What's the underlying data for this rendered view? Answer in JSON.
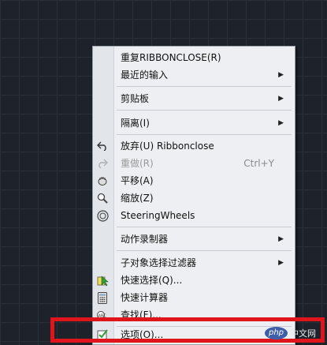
{
  "context_menu": {
    "items": [
      {
        "label": "重复RIBBONCLOSE(R)",
        "icon": "",
        "accel": "",
        "submenu": false
      },
      {
        "label": "最近的输入",
        "icon": "",
        "accel": "",
        "submenu": true
      },
      {
        "label": "剪贴板",
        "icon": "",
        "accel": "",
        "submenu": true
      },
      {
        "label": "隔离(I)",
        "icon": "",
        "accel": "",
        "submenu": true
      },
      {
        "label": "放弃(U) Ribbonclose",
        "icon": "undo-icon",
        "accel": "",
        "submenu": false
      },
      {
        "label": "重做(R)",
        "icon": "redo-icon",
        "accel": "Ctrl+Y",
        "submenu": false,
        "disabled": true
      },
      {
        "label": "平移(A)",
        "icon": "pan-hand-icon",
        "accel": "",
        "submenu": false
      },
      {
        "label": "缩放(Z)",
        "icon": "zoom-icon",
        "accel": "",
        "submenu": false
      },
      {
        "label": "SteeringWheels",
        "icon": "steering-wheel-icon",
        "accel": "",
        "submenu": false
      },
      {
        "label": "动作录制器",
        "icon": "",
        "accel": "",
        "submenu": true
      },
      {
        "label": "子对象选择过滤器",
        "icon": "",
        "accel": "",
        "submenu": true
      },
      {
        "label": "快速选择(Q)...",
        "icon": "quick-select-icon",
        "accel": "",
        "submenu": false
      },
      {
        "label": "快速计算器",
        "icon": "calculator-icon",
        "accel": "",
        "submenu": false
      },
      {
        "label": "查找(F)...",
        "icon": "find-icon",
        "accel": "",
        "submenu": false
      },
      {
        "label": "选项(O)...",
        "icon": "options-check-icon",
        "accel": "",
        "submenu": false
      }
    ]
  },
  "watermark": {
    "logo": "php",
    "text": "中文网"
  },
  "colors": {
    "highlight": "#e0151c",
    "menu_bg": "#edeff2",
    "canvas_bg": "#1e222b"
  }
}
